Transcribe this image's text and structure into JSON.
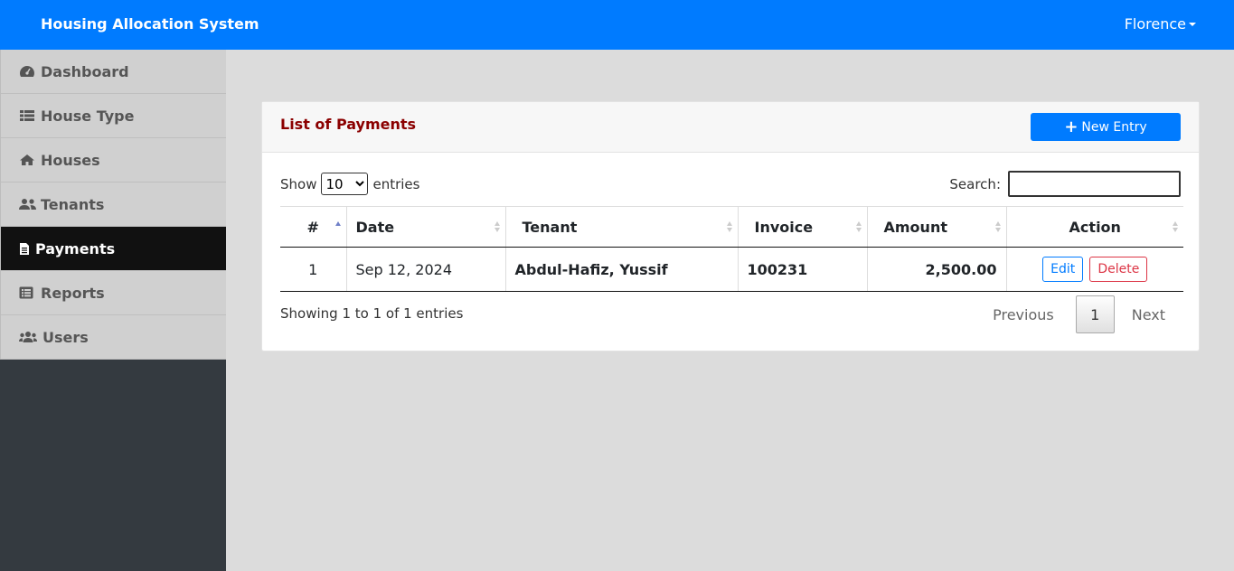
{
  "app": {
    "title": "Housing Allocation System",
    "user": "Florence"
  },
  "sidebar": {
    "items": [
      {
        "label": "Dashboard",
        "icon": "tachometer-icon",
        "active": false
      },
      {
        "label": "House Type",
        "icon": "list-icon",
        "active": false
      },
      {
        "label": "Houses",
        "icon": "home-icon",
        "active": false
      },
      {
        "label": "Tenants",
        "icon": "user-friends-icon",
        "active": false
      },
      {
        "label": "Payments",
        "icon": "file-invoice-icon",
        "active": true
      },
      {
        "label": "Reports",
        "icon": "list-alt-icon",
        "active": false
      },
      {
        "label": "Users",
        "icon": "users-icon",
        "active": false
      }
    ]
  },
  "card": {
    "title": "List of Payments",
    "new_entry_label": "New Entry",
    "show_label": "Show",
    "entries_label": "entries",
    "page_size": "10",
    "search_label": "Search:",
    "search_value": ""
  },
  "table": {
    "columns": [
      "#",
      "Date",
      "Tenant",
      "Invoice",
      "Amount",
      "Action"
    ],
    "rows": [
      {
        "num": "1",
        "date": "Sep 12, 2024",
        "tenant": "Abdul-Hafiz, Yussif",
        "invoice": "100231",
        "amount": "2,500.00",
        "edit": "Edit",
        "delete": "Delete"
      }
    ]
  },
  "footer": {
    "info": "Showing 1 to 1 of 1 entries",
    "previous": "Previous",
    "page": "1",
    "next": "Next"
  },
  "colors": {
    "topbar": "#007bff",
    "sidebar_active": "#111111",
    "title": "#8b0000"
  }
}
